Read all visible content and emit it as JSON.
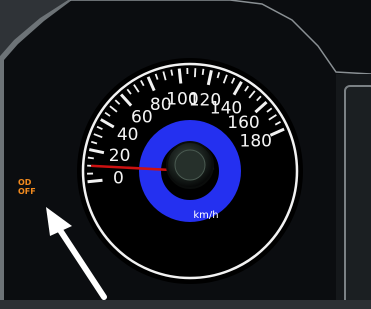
{
  "speedometer": {
    "unit": "km/h",
    "scale_min": 0,
    "scale_max": 180,
    "major_labels": [
      "0",
      "20",
      "40",
      "60",
      "80",
      "100",
      "120",
      "140",
      "160",
      "180"
    ],
    "needle_value": 10
  },
  "indicator": {
    "line1": "OD",
    "line2": "OFF",
    "color": "#f28a1e"
  },
  "colors": {
    "hub_ring": "#2430f0",
    "needle": "#cc1111",
    "dial_face": "#000000",
    "dial_marks": "#f2f2f2",
    "arrow": "#ffffff"
  },
  "annotation_arrow": {
    "icon": "white-pointer-arrow",
    "points_to": "indicator"
  }
}
